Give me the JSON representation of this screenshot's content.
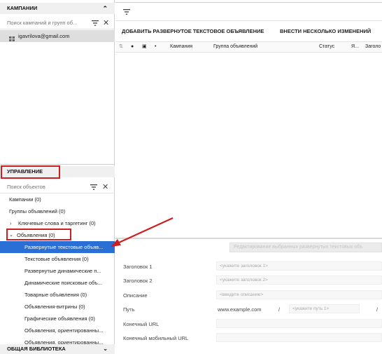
{
  "campaigns": {
    "title": "КАМПАНИИ",
    "search_placeholder": "Поиск кампаний и групп об...",
    "account": "igavrilova@gmail.com"
  },
  "management": {
    "title": "УПРАВЛЕНИЕ",
    "search_placeholder": "Поиск объектов",
    "items": [
      "Кампании (0)",
      "Группы объявлений (0)",
      "Ключевые слова и таргетинг (0)",
      "Объявления (0)",
      "Развернутые текстовые объяв...",
      "Текстовые объявления (0)",
      "Развернутые динамические п...",
      "Динамические поисковые объ...",
      "Товарные объявления (0)",
      "Объявления-витрины (0)",
      "Графические объявления (0)",
      "Объявления, ориентированны...",
      "Объявления, ориентированны..."
    ]
  },
  "library": {
    "title": "ОБЩАЯ БИБЛИОТЕКА"
  },
  "toolbar": {
    "add_button": "ДОБАВИТЬ РАЗВЕРНУТОЕ ТЕКСТОВОЕ ОБЪЯВЛЕНИЕ",
    "multi_edit_button": "ВНЕСТИ НЕСКОЛЬКО ИЗМЕНЕНИЙ"
  },
  "table": {
    "columns": [
      "Кампания",
      "Группа объявлений",
      "Статус",
      "Я...",
      "Заголо"
    ]
  },
  "editor": {
    "banner": "Редактирование выбранных развернутых текстовых объ",
    "headline1_label": "Заголовок 1",
    "headline1_placeholder": "<укажите заголовок 1>",
    "headline2_label": "Заголовок 2",
    "headline2_placeholder": "<укажите заголовок 2>",
    "description_label": "Описание",
    "description_placeholder": "<введите описание>",
    "path_label": "Путь",
    "path_domain": "www.example.com",
    "path_sep": "/",
    "path1_placeholder": "<укажите путь 1>",
    "final_url_label": "Конечный URL",
    "final_mobile_url_label": "Конечный мобильный URL"
  },
  "colors": {
    "selection": "#2a6fd6",
    "highlight_box": "#cc1f1f",
    "arrow": "#cc1f1f"
  }
}
